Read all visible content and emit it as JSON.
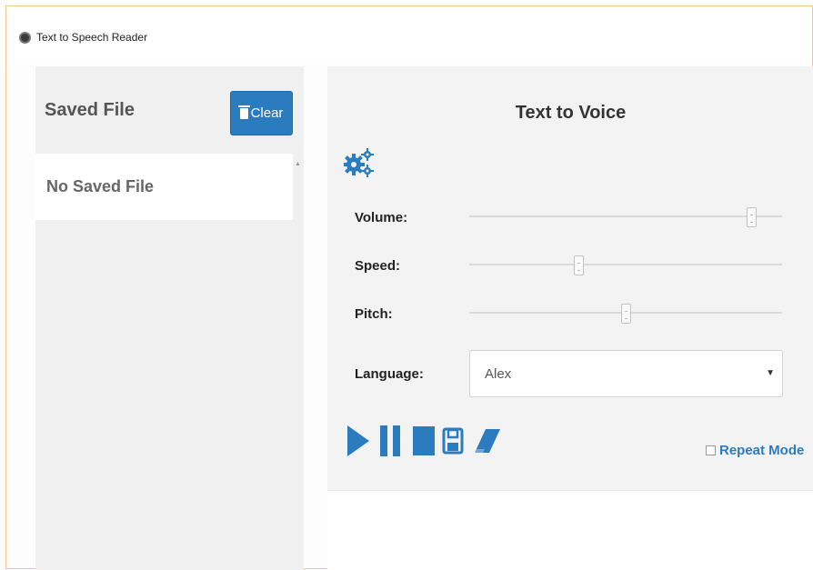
{
  "window": {
    "title": "Text to Speech Reader"
  },
  "left_panel": {
    "title": "Saved File",
    "clear_label": "Clear",
    "empty_text": "No Saved File"
  },
  "right_panel": {
    "title": "Text to Voice",
    "volume": {
      "label": "Volume:",
      "value": 0.9
    },
    "speed": {
      "label": "Speed:",
      "value": 0.35
    },
    "pitch": {
      "label": "Pitch:",
      "value": 0.5
    },
    "language": {
      "label": "Language:",
      "selected": "Alex"
    },
    "repeat_mode": {
      "label": "Repeat Mode",
      "checked": false
    }
  },
  "colors": {
    "accent": "#2b7bbf",
    "window_border": "#f0c98a"
  },
  "icons": [
    "gears-icon",
    "play-icon",
    "pause-icon",
    "stop-icon",
    "save-icon",
    "eraser-icon",
    "trash-icon"
  ]
}
